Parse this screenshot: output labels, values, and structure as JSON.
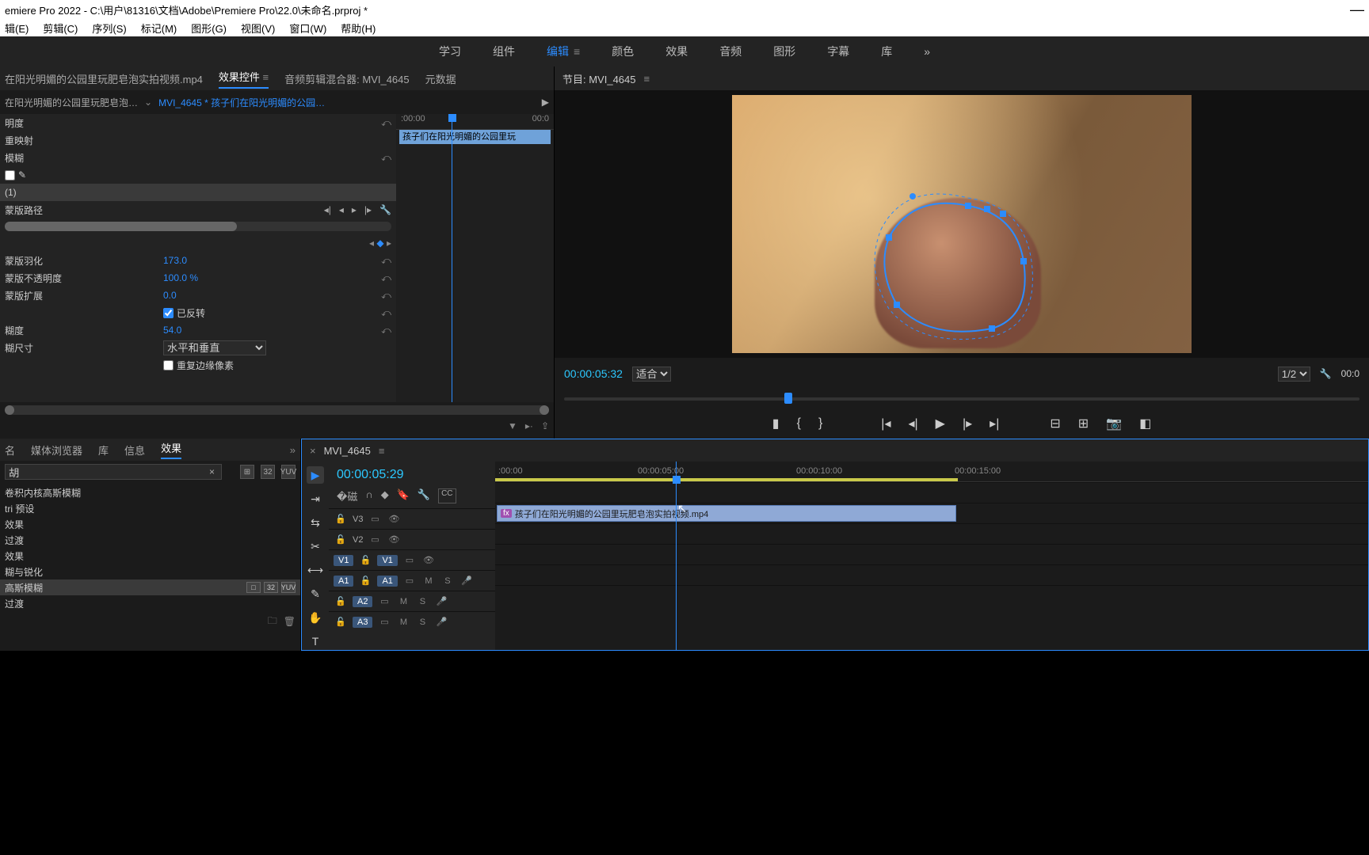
{
  "title": "emiere Pro 2022 - C:\\用户\\81316\\文档\\Adobe\\Premiere Pro\\22.0\\未命名.prproj *",
  "win_min": "—",
  "menubar": [
    "辑(E)",
    "剪辑(C)",
    "序列(S)",
    "标记(M)",
    "图形(G)",
    "视图(V)",
    "窗口(W)",
    "帮助(H)"
  ],
  "workspace": {
    "tabs": [
      "学习",
      "组件",
      "编辑",
      "颜色",
      "效果",
      "音频",
      "图形",
      "字幕",
      "库"
    ],
    "active": 2,
    "overflow": "»"
  },
  "ec": {
    "tabs": [
      "在阳光明媚的公园里玩肥皂泡实拍视频.mp4",
      "效果控件",
      "音频剪辑混合器: MVI_4645",
      "元数据"
    ],
    "active": 1,
    "bc_src": "在阳光明媚的公园里玩肥皂泡…",
    "bc_seq": "MVI_4645 * 孩子们在阳光明媚的公园里…",
    "mini_start": ":00:00",
    "mini_end": "00:0",
    "mini_clip": "孩子们在阳光明媚的公园里玩",
    "rows": [
      {
        "lbl": "明度"
      },
      {
        "lbl": "重映射"
      },
      {
        "lbl": "模糊",
        "reset": true
      },
      {
        "lbl": "",
        "pen": true,
        "checkbox": true
      },
      {
        "lbl": "(1)",
        "hl": true
      },
      {
        "lbl": "蒙版路径",
        "kf": true
      },
      {
        "lbl": "蒙版羽化",
        "val": "173.0",
        "reset": true
      },
      {
        "lbl": "蒙版不透明度",
        "val": "100.0 %",
        "reset": true
      },
      {
        "lbl": "蒙版扩展",
        "val": "0.0",
        "reset": true
      },
      {
        "lbl": "",
        "check": true,
        "chklbl": "已反转",
        "reset": true
      },
      {
        "lbl": "糊度",
        "val": "54.0",
        "reset": true
      },
      {
        "lbl": "糊尺寸",
        "select": "水平和垂直"
      },
      {
        "lbl": "",
        "check": false,
        "chklbl": "重复边缘像素"
      }
    ]
  },
  "program": {
    "title": "节目: MVI_4645",
    "tc": "00:00:05:32",
    "fit": "适合",
    "zoom": "1/2",
    "tc_end": "00:0"
  },
  "fx": {
    "tabs": [
      "名",
      "媒体浏览器",
      "库",
      "信息",
      "效果"
    ],
    "active": 4,
    "more": "»",
    "search": "胡",
    "icons": [
      "⊞",
      "32",
      "YUV"
    ],
    "items": [
      {
        "lbl": "卷积内核高斯模糊"
      },
      {
        "lbl": "tri 预设"
      },
      {
        "lbl": "效果"
      },
      {
        "lbl": "过渡"
      },
      {
        "lbl": "效果"
      },
      {
        "lbl": "糊与锐化"
      },
      {
        "lbl": "高斯模糊",
        "sel": true,
        "badges": [
          "□",
          "32",
          "YUV"
        ]
      },
      {
        "lbl": "过渡"
      }
    ]
  },
  "tl": {
    "seq": "MVI_4645",
    "tc": "00:00:05:29",
    "ruler": [
      ":00:00",
      "00:00:05:00",
      "00:00:10:00",
      "00:00:15:00"
    ],
    "tracks": {
      "v3": "V3",
      "v2": "V2",
      "v1l": "V1",
      "v1r": "V1",
      "a1l": "A1",
      "a1r": "A1",
      "a2": "A2",
      "a3": "A3"
    },
    "ms": {
      "m": "M",
      "s": "S"
    },
    "clip": "孩子们在阳光明媚的公园里玩肥皂泡实拍视频.mp4",
    "fx": "fx"
  }
}
